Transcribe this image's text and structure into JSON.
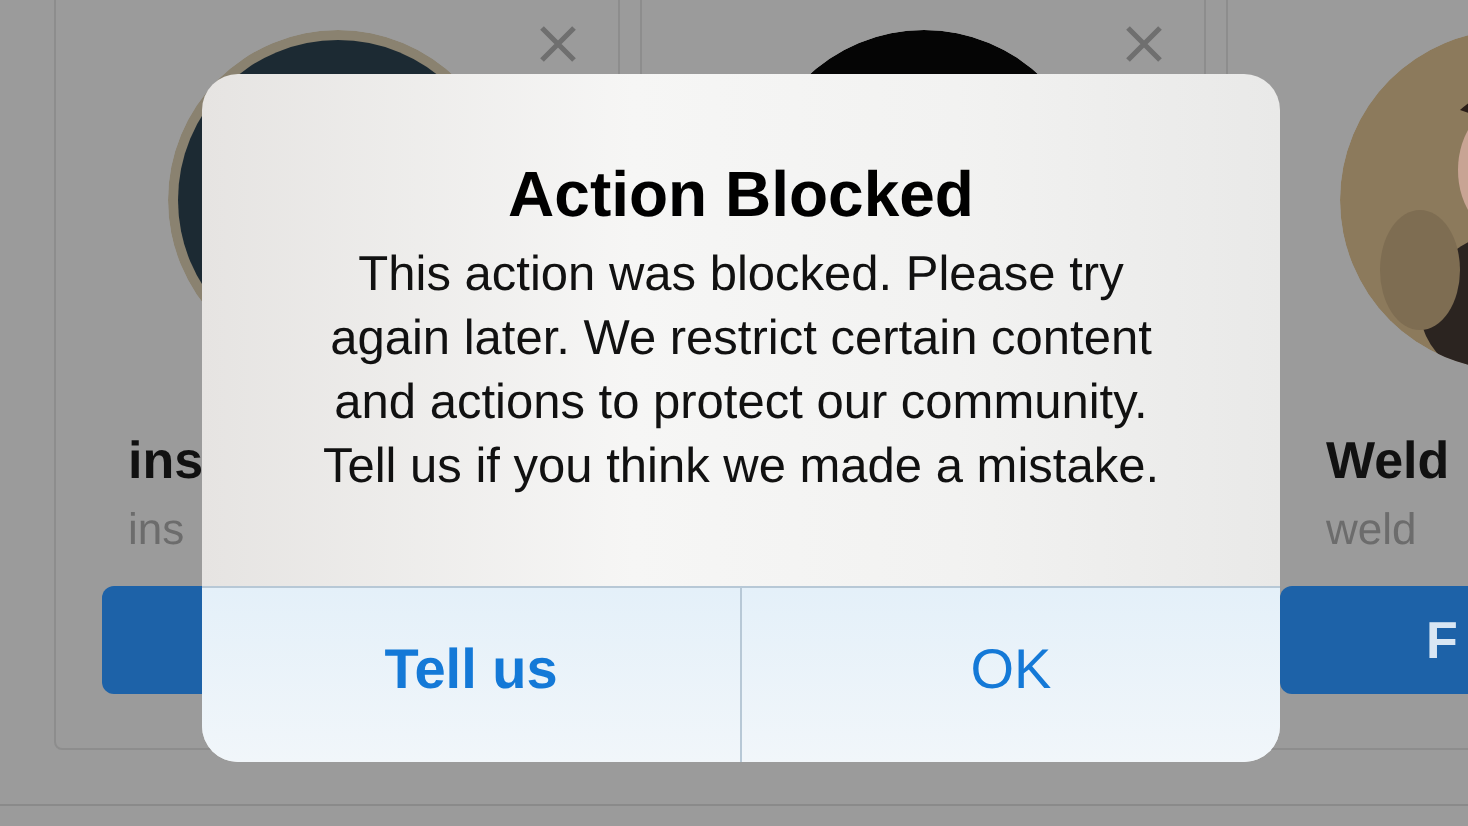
{
  "cards": [
    {
      "avatar": {
        "kind": "picture"
      },
      "name": "ins",
      "username": "ins"
    },
    {
      "avatar": {
        "kind": "picture"
      }
    },
    {
      "avatar": {
        "kind": "picture"
      },
      "name": "Weld",
      "username": "weld",
      "follow_label": "F"
    }
  ],
  "alert": {
    "title": "Action Blocked",
    "message": "This action was blocked. Please try\nagain later. We restrict certain content\nand actions to protect our community.\nTell us if you think we made a mistake.",
    "buttons": [
      {
        "label": "Tell us",
        "kind": "preferred"
      },
      {
        "label": "OK",
        "kind": "default"
      }
    ]
  }
}
